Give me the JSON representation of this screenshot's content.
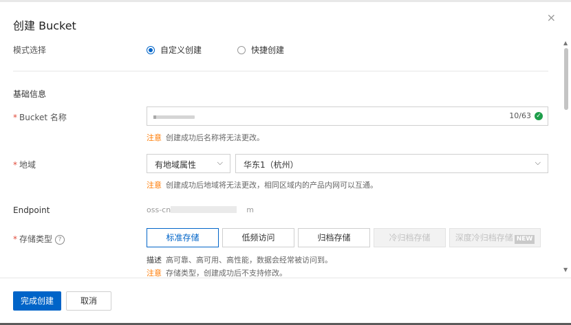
{
  "dialog": {
    "title": "创建 Bucket",
    "close_icon": "×"
  },
  "mode": {
    "label": "模式选择",
    "options": [
      {
        "label": "自定义创建",
        "selected": true
      },
      {
        "label": "快捷创建",
        "selected": false
      }
    ]
  },
  "basic_section": "基础信息",
  "bucket_name": {
    "required_mark": "*",
    "label": "Bucket 名称",
    "counter": "10/63",
    "valid_icon": "✓",
    "note_prefix": "注意",
    "note_text": "创建成功后名称将无法更改。"
  },
  "region": {
    "required_mark": "*",
    "label": "地域",
    "attribute_select": "有地域属性",
    "region_select": "华东1（杭州）",
    "chevron": "⌵",
    "note_prefix": "注意",
    "note_text": "创建成功后地域将无法更改，相同区域内的产品内网可以互通。"
  },
  "endpoint": {
    "label": "Endpoint",
    "prefix": "oss-cn",
    "suffix": "m"
  },
  "storage": {
    "required_mark": "*",
    "label": "存储类型",
    "help_icon": "?",
    "options": [
      {
        "label": "标准存储",
        "state": "active"
      },
      {
        "label": "低频访问",
        "state": "normal"
      },
      {
        "label": "归档存储",
        "state": "normal"
      },
      {
        "label": "冷归档存储",
        "state": "disabled"
      },
      {
        "label": "深度冷归档存储",
        "state": "disabled",
        "badge": "NEW"
      }
    ],
    "desc_prefix": "描述",
    "desc_text": "高可靠、高可用、高性能，数据会经常被访问到。",
    "note_prefix": "注意",
    "note_text": "存储类型，创建成功后不支持修改。"
  },
  "footer": {
    "confirm": "完成创建",
    "cancel": "取消"
  },
  "colors": {
    "primary": "#0064c8",
    "warning": "#ff7a00",
    "success": "#1e9e4a",
    "required": "#e04b3a"
  }
}
